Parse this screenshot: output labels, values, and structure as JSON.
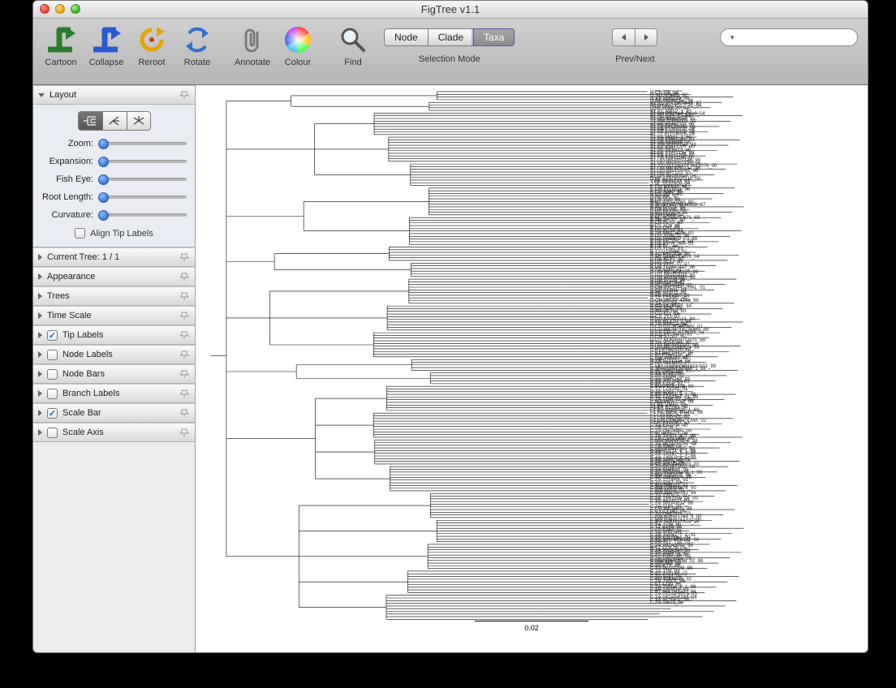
{
  "window": {
    "title": "FigTree v1.1"
  },
  "toolbar": {
    "buttons": {
      "cartoon": "Cartoon",
      "collapse": "Collapse",
      "reroot": "Reroot",
      "rotate": "Rotate",
      "annotate": "Annotate",
      "colour": "Colour",
      "find": "Find"
    },
    "selection_mode": {
      "label": "Selection Mode",
      "options": [
        "Node",
        "Clade",
        "Taxa"
      ],
      "selected": "Taxa"
    },
    "prevnext": {
      "label": "Prev/Next"
    },
    "search": {
      "placeholder": ""
    }
  },
  "sidebar": {
    "layout": {
      "title": "Layout",
      "sliders": {
        "zoom": "Zoom:",
        "expansion": "Expansion:",
        "fisheye": "Fish Eye:",
        "rootlength": "Root Length:",
        "curvature": "Curvature:"
      },
      "align_tip": "Align Tip Labels"
    },
    "sections": [
      {
        "label": "Current Tree: 1 / 1",
        "checkbox": null
      },
      {
        "label": "Appearance",
        "checkbox": null
      },
      {
        "label": "Trees",
        "checkbox": null
      },
      {
        "label": "Time Scale",
        "checkbox": null
      },
      {
        "label": "Tip Labels",
        "checkbox": true
      },
      {
        "label": "Node Labels",
        "checkbox": false
      },
      {
        "label": "Node Bars",
        "checkbox": false
      },
      {
        "label": "Branch Labels",
        "checkbox": false
      },
      {
        "label": "Scale Bar",
        "checkbox": true
      },
      {
        "label": "Scale Axis",
        "checkbox": false
      }
    ]
  },
  "canvas": {
    "scale_bar_value": "0.02",
    "tip_labels": [
      "H.BE.V991_93",
      "H.CF.056_96",
      "G.NG.NG083_92",
      "G.KE.HH8793_98",
      "G.BE.96DRCBL_96",
      "A2.CD.97CDKTB48_97",
      "A2.CY.94CY017_41_94",
      "U.NE.03NE20_03",
      "A1.KE.MB52_1_93",
      "A1.AU.PS1044_Day0_04",
      "A1.KE.Q23_17_94",
      "A1.UG.92UG037_92",
      "A1.RW.92RW008_92",
      "A1.KE.KER2008_06",
      "A1.TZ.01TZA341_01",
      "A1.KE.KSM4030_06",
      "A1.KE.KISII5009_06",
      "A1.TZ.KITU4005_06",
      "A1.KE.MB61_1_93",
      "A1.KE.KNH1088_03",
      "A1.SE.SE8538_95",
      "A1.RW.93RW024_93",
      "A1.KE.KNH1207_00",
      "A1.SE.SE8613_96",
      "A1.KE.KNH1135_99",
      "A1.KE.KNH1209_00",
      "A1.KE.KNH1199_00",
      "A1.UG.98UG57136_98",
      "A1.UG.98UG57148_98",
      "A1.TZ.O1TZA173_tb12076_00",
      "A1.UG.99UG57131_98",
      "A1.UG.99UGA097_06",
      "A1.UG.97TZ02_97",
      "A1.UG.99UGA0V_06",
      "D.KE.97SQDV0110_00",
      "J.SE.SE91733_93",
      "J.SE.SE92809_94",
      "K.CM.MP535_96",
      "K.CM.EQTB11_96",
      "K.CD.A280_84",
      "B.US.JRFL_86",
      "B.AK.WK_97",
      "B.US.YU2_86",
      "B.US.WEAU160_90",
      "B.JP.JPH987AFnSCD_87",
      "B.AU.BH111_99",
      "B.GB.MANC_83",
      "B.US.BCSG3_86",
      "B.TW.LM49_94",
      "B.NL.ACH320_671_83",
      "B.TH.TH007_90",
      "B.CN.RL42_93",
      "B.US.AD8_86",
      "B.GA.OYI_88",
      "B.US.SC09_98",
      "B.TH.NH1_ds46_00",
      "B.US.1058_11_95",
      "B.US.PRB959_03_98",
      "B.US.WC10C_1_03",
      "B.US.93TH_305_93",
      "B.US.BC_84",
      "B.US.YU10_83",
      "B.TT.QZ4589_01",
      "B.AU.MBC925_95",
      "B.AR.04AR151516_04",
      "U.GA.BCF7_97",
      "B.US.SC12_95",
      "B.US.1012_11_97",
      "B.US.11299_d22_96",
      "D.TZ.A280_01",
      "D.UG.99UG08259_99",
      "D.UG.98UG0035_01",
      "D.UG.A03349M1_99",
      "D.UG.57128_98",
      "D.UG.J12_3_91",
      "D.KE.NKU3006_00",
      "D.CM.01CM4412HAL_01",
      "D.CD.214HA_04",
      "D.TD.MN011_99",
      "D.KE.01KW50_96",
      "D.TZ.TZA341_01",
      "D.CM.96CM_4298_96",
      "D.ZA.R2_84",
      "D.CD.84ZR085_84",
      "D.CD.NDK_83",
      "D.SN.SE365_90",
      "D.CD.ELI_83",
      "D.CD.JY1_97",
      "D.UG.94UG1141_94",
      "D.KE.ML170_2_95",
      "D.TD.MN012_99",
      "D.CD.01CM1445MV_01",
      "D.CD.99CMUOC26830_99",
      "D.CD.02CD_KTB035_02",
      "D.CD.83CD003_91",
      "D.CM.A1007_97",
      "D.CD.NDK95STO101_99",
      "D.SN.90SE365_90",
      "D.UG.98UG57131_98",
      "D.UG.98UGHB624_98",
      "C.ET.ETH2220_86",
      "C.ET.86ETH427_86",
      "C.ET.ETH1430_86",
      "C.BW.96BW0_86",
      "D.YE.02YE511_02",
      "D.KR.04KMH5_07",
      "C.MM.00MMYMmSDU101_99",
      "C.SN.00SNTS1925_1_98",
      "C.IN.TNIN1188_95",
      "C.ZA.9734_99",
      "C.ZA.21068_01",
      "C.ZA.TNIN144_93",
      "C.ZA.701_240_01",
      "C.ZA.EA05_97",
      "C.BW.PBW1186_00",
      "C.TZ.TZA141_01",
      "C.ZA.1243_77",
      "C.ZA.TV001_8_1_98",
      "C.TZ.TZA1357_c1_98",
      "C.ZA.1186_c7_2000",
      "C.BW.PBW1168_96",
      "F1.BE.VI850_93",
      "F1.BR.BZ163_94",
      "F1.BR.93BR020_1_93",
      "F1.FR.96FR_MP411_96",
      "F2.CM.MP257_95",
      "F2.CM.MP255_95",
      "F2.CM.CM5365_CMA_02",
      "F1.FI.FIN9363_93",
      "C.ZA.EA1104_00",
      "C.ZA.1176_C",
      "C.ZA.DI677dps_00",
      "C.IN.98IN027_98",
      "C.ZA.TV001_5_1_98",
      "C.ZA.C1IN.1880_00",
      "C.MW.98MW33_6_98",
      "C.ZA.98ZADu151_98",
      "C.ZA.1069_04",
      "C.MW.93MW965_93",
      "C.ZA.TV014_6_1_99",
      "C.ZA.TV047_7_1_01",
      "C.ZA.TV002_5_1_99",
      "C.ZA.1184_C3_01",
      "C.ZA.COT6_89",
      "C.GE.03GEMZ003_03",
      "C.ZA.SK157.012_98",
      "C.ZA.1163MB_00",
      "C.ZA.98ZADu178_1_99",
      "C.BW.98BW08_98",
      "C.BR.98BR004_98",
      "C.ZA.1214HA_01",
      "C.ZA.1217_03",
      "C.BW.96BW1_02",
      "C.BW.00BW3876_00",
      "C.BW.ANV8_01",
      "C.BW.98BW5393_88",
      "C.ZA.1214C5_01",
      "C.ZA.TV011c8_04_00",
      "C.ZA.99ZACD_99",
      "C.ZA.99ZA0012_99",
      "C.ZA.1184_00",
      "C.CH.98CH605_98",
      "C.CY.CY260_05",
      "C.ZA.Q842d14_03",
      "C.BW.00BW1783_5_00",
      "C.BW.00BW2127_2_00",
      "C.BW.96BW17A09_96",
      "C.ZA.1134_00",
      "C.TZ.A246_04",
      "C.ZA.E343_02",
      "C.ZA.1157_00",
      "C.ZA.TV047_7_1_01",
      "C.ZA.C2L5dps_00",
      "C.ZA.SW19QK142_00",
      "C.ZA.T22_T16_03",
      "C.ZA.99ZASW7_99",
      "C.TZ.CO178_05",
      "C.ZA.99ZA396_99",
      "C.ZA.1189HA_00",
      "C.ZA.F987_d5_98",
      "C.ZA.DI874dps_00",
      "C.MW.98MW959_02_98",
      "C.MW.965_98",
      "C.ZA.KTX_99",
      "C.ZA.99ZACM9_99",
      "C.ZA.J7M_99",
      "C.ZA.ZA1184_02",
      "C.ZA.1214_00",
      "C.BR.92BR025_92",
      "C.ZA.TV001_98",
      "C.ET.1230_86",
      "C.ZA.TV001_8_1_98",
      "C.ZA.SM1819_03",
      "C.ET.86ETH2220_86",
      "C.ZA.03ZAPS019_03",
      "C.ZA.04ZASK164_04",
      "C.ZA.NCS502_98",
      "C.ZA.SM29_99"
    ]
  }
}
